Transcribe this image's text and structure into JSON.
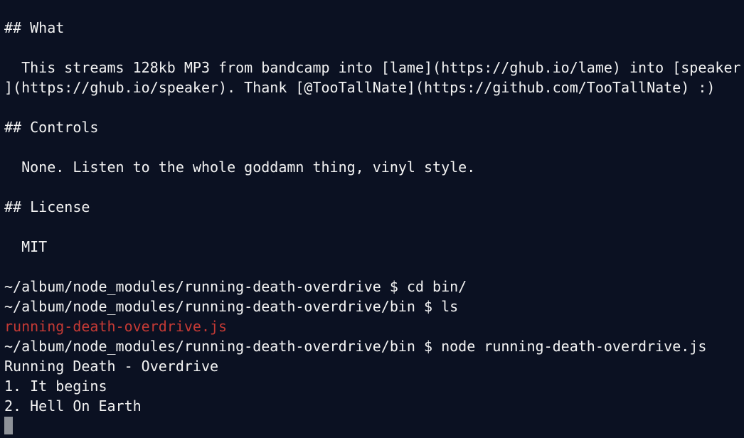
{
  "terminal": {
    "lines": [
      "## What",
      "  This streams 128kb MP3 from bandcamp into [lame](https://ghub.io/lame) into [speaker",
      "](https://ghub.io/speaker). Thank [@TooTallNate](https://github.com/TooTallNate) :)",
      "## Controls",
      "  None. Listen to the whole goddamn thing, vinyl style.",
      "## License",
      "  MIT",
      "~/album/node_modules/running-death-overdrive $ cd bin/",
      "~/album/node_modules/running-death-overdrive/bin $ ls",
      "running-death-overdrive.js",
      "~/album/node_modules/running-death-overdrive/bin $ node running-death-overdrive.js",
      "Running Death - Overdrive",
      "1. It begins",
      "2. Hell On Earth"
    ],
    "colors": {
      "background": "#0b1122",
      "foreground": "#f3f3f3",
      "file": "#c53a35",
      "cursor": "#8f9399"
    }
  }
}
